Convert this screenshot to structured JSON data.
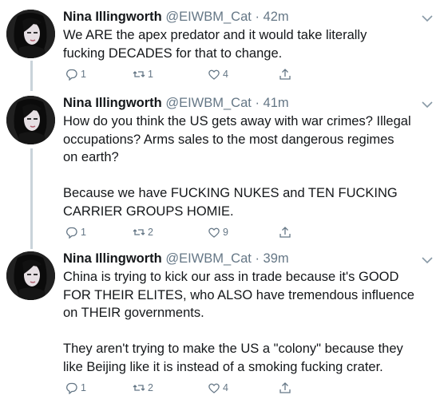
{
  "tweets": [
    {
      "name": "Nina Illingworth",
      "handle": "@EIWBM_Cat",
      "time": "· 42m",
      "text": "We ARE the apex predator and it would take literally\nfucking DECADES for that to change.",
      "replies": "1",
      "retweets": "1",
      "likes": "4"
    },
    {
      "name": "Nina Illingworth",
      "handle": "@EIWBM_Cat",
      "time": "· 41m",
      "text": "How do you think the US gets away with war crimes? Illegal\noccupations? Arms sales to the most dangerous regimes\non earth?\n\nBecause we have FUCKING NUKES and TEN FUCKING\nCARRIER GROUPS HOMIE.",
      "replies": "1",
      "retweets": "2",
      "likes": "9"
    },
    {
      "name": "Nina Illingworth",
      "handle": "@EIWBM_Cat",
      "time": "· 39m",
      "text": "China is trying to kick our ass in trade because it's GOOD\nFOR THEIR ELITES, who ALSO have tremendous influence\non THEIR governments.\n\nThey aren't trying to make the US a \"colony\" because they\nlike Beijing like it is instead of a smoking fucking crater.",
      "replies": "1",
      "retweets": "2",
      "likes": "4"
    }
  ],
  "icons": {
    "reply": "reply-icon",
    "retweet": "retweet-icon",
    "like": "heart-icon",
    "share": "share-icon",
    "more": "chevron-down-icon"
  },
  "colors": {
    "name": "#14171a",
    "meta": "#657786",
    "thread_line": "#c9d3da"
  }
}
